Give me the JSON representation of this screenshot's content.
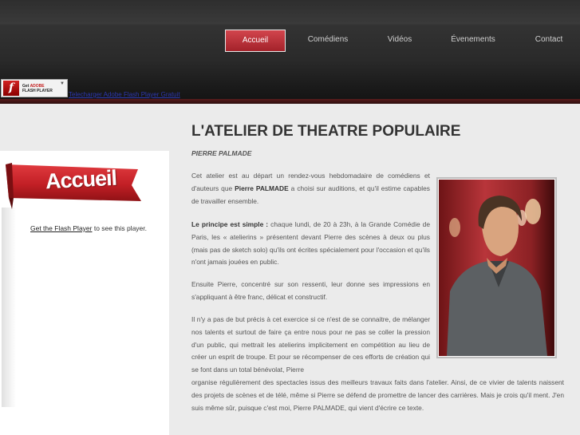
{
  "nav": {
    "items": [
      {
        "label": "Accueil",
        "active": true
      },
      {
        "label": "Comédiens",
        "active": false
      },
      {
        "label": "Vidéos",
        "active": false
      },
      {
        "label": "Évenements",
        "active": false
      },
      {
        "label": "Contact",
        "active": false
      }
    ]
  },
  "flash_badge": {
    "get": "Get",
    "adobe": "ADOBE",
    "product": "FLASH PLAYER"
  },
  "top_link": "Telecharger Adobe Flash Player Gratuit",
  "sidebar": {
    "ribbon_label": "Accueil",
    "flash_note_link": "Get the Flash Player",
    "flash_note_text": " to see this player."
  },
  "main": {
    "title": "L'ATELIER DE THEATRE POPULAIRE",
    "author": "PIERRE PALMADE",
    "p1_a": "Cet atelier est au départ un rendez-vous hebdomadaire de comédiens et d'auteurs que ",
    "p1_b": "Pierre PALMADE",
    "p1_c": " a choisi sur auditions, et qu'il estime capables de travailler ensemble.",
    "p2_a": "Le principe est simple :",
    "p2_b": " chaque lundi, de 20 à 23h, à la Grande Comédie de Paris, les « atelierins » présentent devant Pierre des scènes à deux ou plus (mais pas de sketch solo) qu'ils ont écrites spécialement pour l'occasion et qu'ils n'ont jamais jouées en public.",
    "p3": "Ensuite Pierre, concentré sur son ressenti, leur donne ses impressions en s'appliquant à être franc, délicat et constructif.",
    "p4": "Il n'y a pas de but précis à cet exercice si ce n'est de se connaitre, de mélanger nos talents et surtout de faire ça entre nous pour ne pas se coller la pression d'un public, qui mettrait les atelierins implicitement en compétition au lieu de créer un esprit de troupe. Et pour se récompenser de ces efforts de création qui se font dans un total bénévolat, Pierre",
    "p5": "organise régulièrement des spectacles issus des meilleurs travaux faits dans l'atelier. Ainsi, de ce vivier de talents naissent des projets de scènes et de télé, même si Pierre se défend de promettre de lancer des carrières. Mais je crois qu'il ment. J'en suis même sûr, puisque c'est moi, Pierre PALMADE, qui vient d'écrire ce texte."
  },
  "colors": {
    "accent": "#c0333a",
    "header": "#2e2e2e",
    "background": "#ebebeb"
  }
}
